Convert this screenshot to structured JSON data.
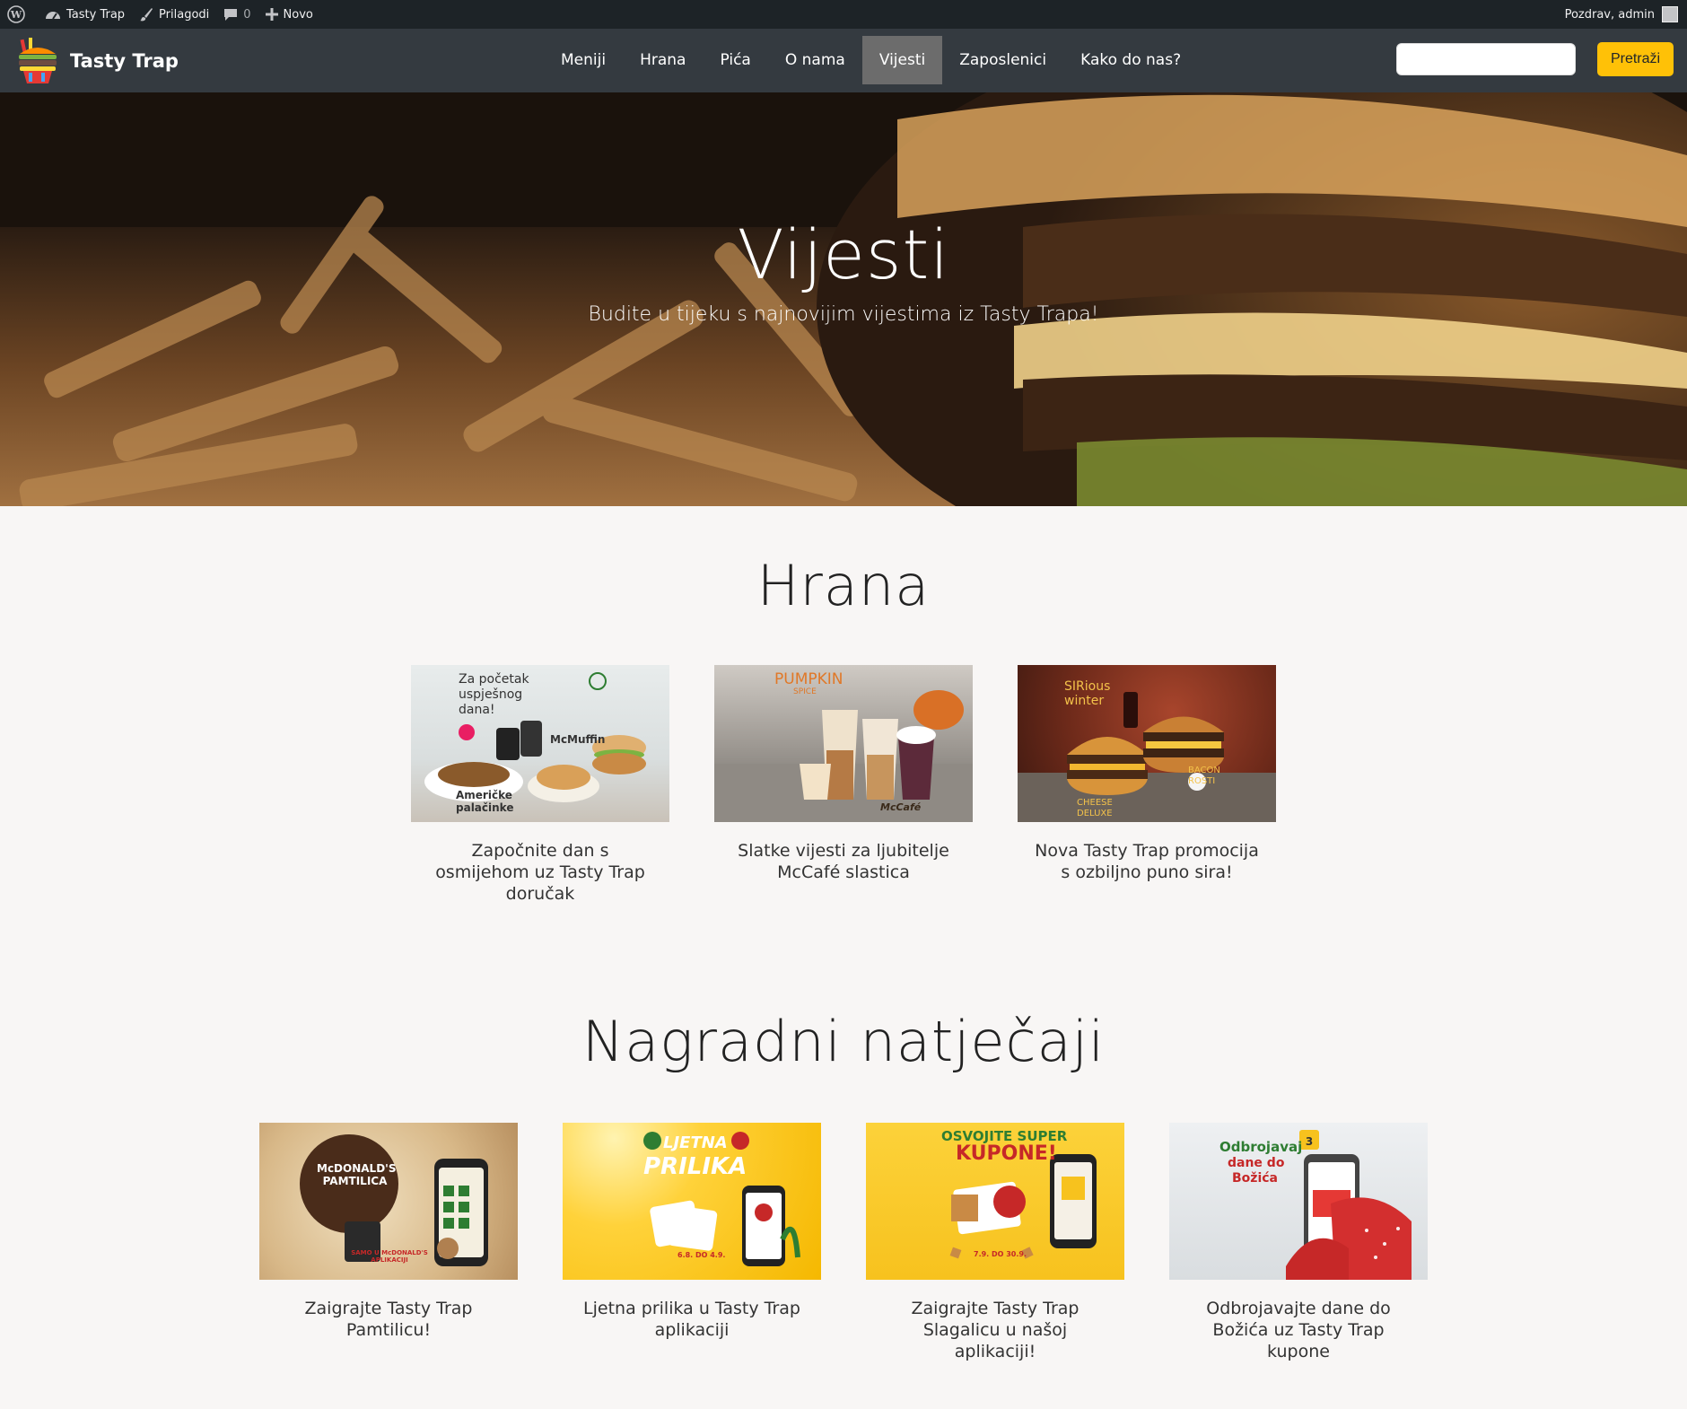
{
  "adminbar": {
    "site_name": "Tasty Trap",
    "customize": "Prilagodi",
    "comments_count": "0",
    "new": "Novo",
    "greeting": "Pozdrav, admin"
  },
  "nav": {
    "brand": "Tasty Trap",
    "items": [
      "Meniji",
      "Hrana",
      "Pića",
      "O nama",
      "Vijesti",
      "Zaposlenici",
      "Kako do nas?"
    ],
    "active": "Vijesti",
    "search_value": "",
    "search_button": "Pretraži"
  },
  "hero": {
    "title": "Vijesti",
    "subtitle": "Budite u tijeku s najnovijim vijestima iz Tasty Trapa!"
  },
  "sections": [
    {
      "title": "Hrana",
      "cards": [
        {
          "caption": "Započnite dan s osmijehom uz Tasty Trap doručak",
          "img_text": [
            "Za početak uspješnog dana!",
            "McMuffin",
            "Američke palačinke"
          ]
        },
        {
          "caption": "Slatke vijesti za ljubitelje McCafé slastica",
          "img_text": [
            "PUMPKIN",
            "SPICE",
            "McCafé"
          ]
        },
        {
          "caption": "Nova Tasty Trap promocija s ozbiljno puno sira!",
          "img_text": [
            "SIRious winter",
            "BACON ROSTI",
            "CHEESE DELUXE"
          ]
        }
      ]
    },
    {
      "title": "Nagradni natječaji",
      "cards": [
        {
          "caption": "Zaigrajte Tasty Trap Pamtilicu!",
          "img_text": [
            "McDONALD'S PAMTILICA",
            "SAMO U McDONALD'S APLIKACIJI"
          ]
        },
        {
          "caption": "Ljetna prilika u Tasty Trap aplikaciji",
          "img_text": [
            "LJETNA",
            "PRILIKA",
            "6.8. DO 4.9."
          ]
        },
        {
          "caption": "Zaigrajte Tasty Trap Slagalicu u našoj aplikaciji!",
          "img_text": [
            "OSVOJITE SUPER",
            "KUPONE!",
            "7.9. DO 30.9."
          ]
        },
        {
          "caption": "Odbrojavajte dane do Božića uz Tasty Trap kupone",
          "img_text": [
            "Odbrojavaj",
            "dane do",
            "Božića"
          ]
        }
      ]
    }
  ],
  "colors": {
    "adminbar": "#1d2327",
    "navbar": "#343a40",
    "accent": "#ffc107",
    "page_bg": "#f8f6f5"
  }
}
